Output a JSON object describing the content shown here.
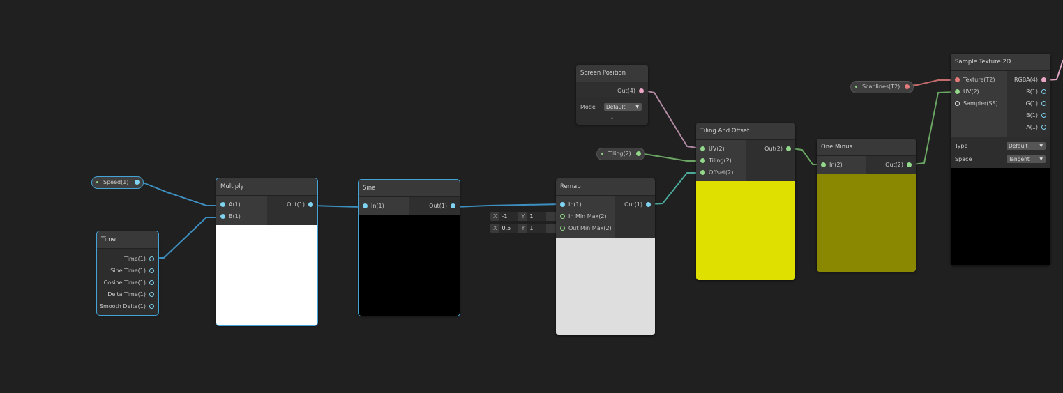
{
  "colors": {
    "background": "#202020",
    "node": "#2d2d2d",
    "selection": "#44a4d8",
    "float_port": "#7fd3f0",
    "vec2_port": "#92d78a",
    "vec4_port": "#e9a5c4",
    "texture_port": "#e47b7b"
  },
  "nodes": {
    "time": {
      "title": "Time",
      "outputs": [
        "Time(1)",
        "Sine Time(1)",
        "Cosine Time(1)",
        "Delta Time(1)",
        "Smooth Delta(1)"
      ]
    },
    "multiply": {
      "title": "Multiply",
      "inputs": [
        "A(1)",
        "B(1)"
      ],
      "output": "Out(1)",
      "preview_color": "#ffffff"
    },
    "sine": {
      "title": "Sine",
      "input": "In(1)",
      "output": "Out(1)",
      "preview_color": "#000000"
    },
    "remap": {
      "title": "Remap",
      "inputs": [
        "In(1)",
        "In Min Max(2)",
        "Out Min Max(2)"
      ],
      "output": "Out(1)",
      "preview_color": "#dedede",
      "in_min_max": {
        "x_label": "X",
        "x": "-1",
        "y_label": "Y",
        "y": "1"
      },
      "out_min_max": {
        "x_label": "X",
        "x": "0.5",
        "y_label": "Y",
        "y": "1"
      }
    },
    "screen_position": {
      "title": "Screen Position",
      "output": "Out(4)",
      "mode_label": "Mode",
      "mode_value": "Default",
      "expand_icon": "chevron-down-icon"
    },
    "tiling_offset": {
      "title": "Tiling And Offset",
      "inputs": [
        "UV(2)",
        "Tiling(2)",
        "Offset(2)"
      ],
      "output": "Out(2)",
      "preview_color": "#dfe000"
    },
    "one_minus": {
      "title": "One Minus",
      "input": "In(2)",
      "output": "Out(2)",
      "preview_color": "#898800"
    },
    "sample_texture": {
      "title": "Sample Texture 2D",
      "inputs": [
        "Texture(T2)",
        "UV(2)",
        "Sampler(SS)"
      ],
      "outputs": [
        "RGBA(4)",
        "R(1)",
        "G(1)",
        "B(1)",
        "A(1)"
      ],
      "type_label": "Type",
      "type_value": "Default",
      "space_label": "Space",
      "space_value": "Tangent",
      "preview_color": "#000000"
    }
  },
  "properties": {
    "speed": "Speed(1)",
    "tiling": "Tiling(2)",
    "scanlines": "Scanlines(T2)"
  }
}
